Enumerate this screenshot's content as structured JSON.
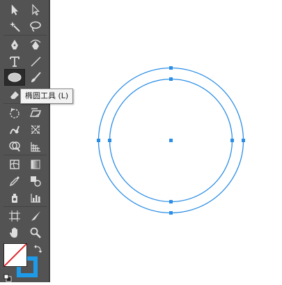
{
  "tooltip": {
    "text": "椭圆工具 (L)"
  },
  "toolbar": {
    "tools": [
      "selection-tool",
      "direct-selection-tool",
      "magic-wand-tool",
      "lasso-tool",
      "pen-tool",
      "curvature-tool",
      "type-tool",
      "line-segment-tool",
      "ellipse-tool",
      "paintbrush-tool",
      "eraser-tool",
      "scissors-tool",
      "rotate-tool",
      "scale-tool",
      "warp-tool",
      "free-transform-tool",
      "shape-builder-tool",
      "perspective-grid-tool",
      "mesh-tool",
      "gradient-tool",
      "eyedropper-tool",
      "blend-tool",
      "symbol-sprayer-tool",
      "column-graph-tool",
      "artboard-tool",
      "slice-tool",
      "hand-tool",
      "zoom-tool"
    ],
    "active_tool": "ellipse-tool"
  },
  "colors": {
    "fill": "#ffffff",
    "stroke": "#1e9be8",
    "selection": "#2a8de6",
    "toolbar_bg": "#535353"
  }
}
